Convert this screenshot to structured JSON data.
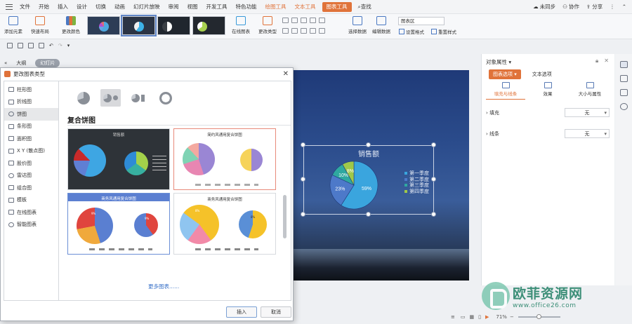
{
  "menubar": {
    "items": [
      "文件",
      "开始",
      "插入",
      "设计",
      "切换",
      "动画",
      "幻灯片放映",
      "审阅",
      "视图",
      "开发工具",
      "特色功能"
    ],
    "context_items": [
      "绘图工具",
      "文本工具"
    ],
    "active_item": "图表工具",
    "search": "查找",
    "right": [
      "未同步",
      "协作",
      "分享"
    ]
  },
  "ribbon": {
    "add_element": "添加元素",
    "quick_layout": "快速布局",
    "change_color": "更改颜色",
    "online_chart": "在线图表",
    "change_type": "更改类型",
    "select_data": "选择数据",
    "edit_data": "编辑数据",
    "chart_area": "图表区",
    "set_format": "设置格式",
    "reset_style": "重置样式"
  },
  "left_tabs": [
    "大纲",
    "幻灯片"
  ],
  "dialog": {
    "title": "更改图表类型",
    "categories": [
      "柱形图",
      "折线图",
      "饼图",
      "条形图",
      "面积图",
      "X Y (散点图)",
      "股价图",
      "雷达图",
      "组合图",
      "模板",
      "在线图表",
      "智能图表"
    ],
    "selected_category": "饼图",
    "section_title": "复合饼图",
    "templates": [
      "销售额",
      "简约风通用复合饼图",
      "商务风通用复合饼图",
      "商务风通用复合饼图"
    ],
    "template_pct": [
      "9%",
      "9%",
      "8%",
      "8%"
    ],
    "more": "更多图表......",
    "insert": "插入",
    "cancel": "取消"
  },
  "chart_data": {
    "type": "pie",
    "title": "销售额",
    "categories": [
      "第一季度",
      "第二季度",
      "第三季度",
      "第四季度"
    ],
    "values": [
      59,
      23,
      10,
      8
    ],
    "labels": [
      "59%",
      "23%",
      "10%",
      "8%"
    ],
    "colors": [
      "#3aa5de",
      "#4d79c9",
      "#2fa8a0",
      "#9fc84a"
    ]
  },
  "right_pane": {
    "title": "对象属性",
    "tabs": [
      "图表选项",
      "文本选项"
    ],
    "subtabs": [
      "填充与线条",
      "效果",
      "大小与属性"
    ],
    "fill_label": "填充",
    "fill_value": "无",
    "line_label": "线条",
    "line_value": "无"
  },
  "status": {
    "zoom": "71%"
  },
  "watermark": {
    "name": "欧菲资源网",
    "url": "www.office26.com"
  }
}
